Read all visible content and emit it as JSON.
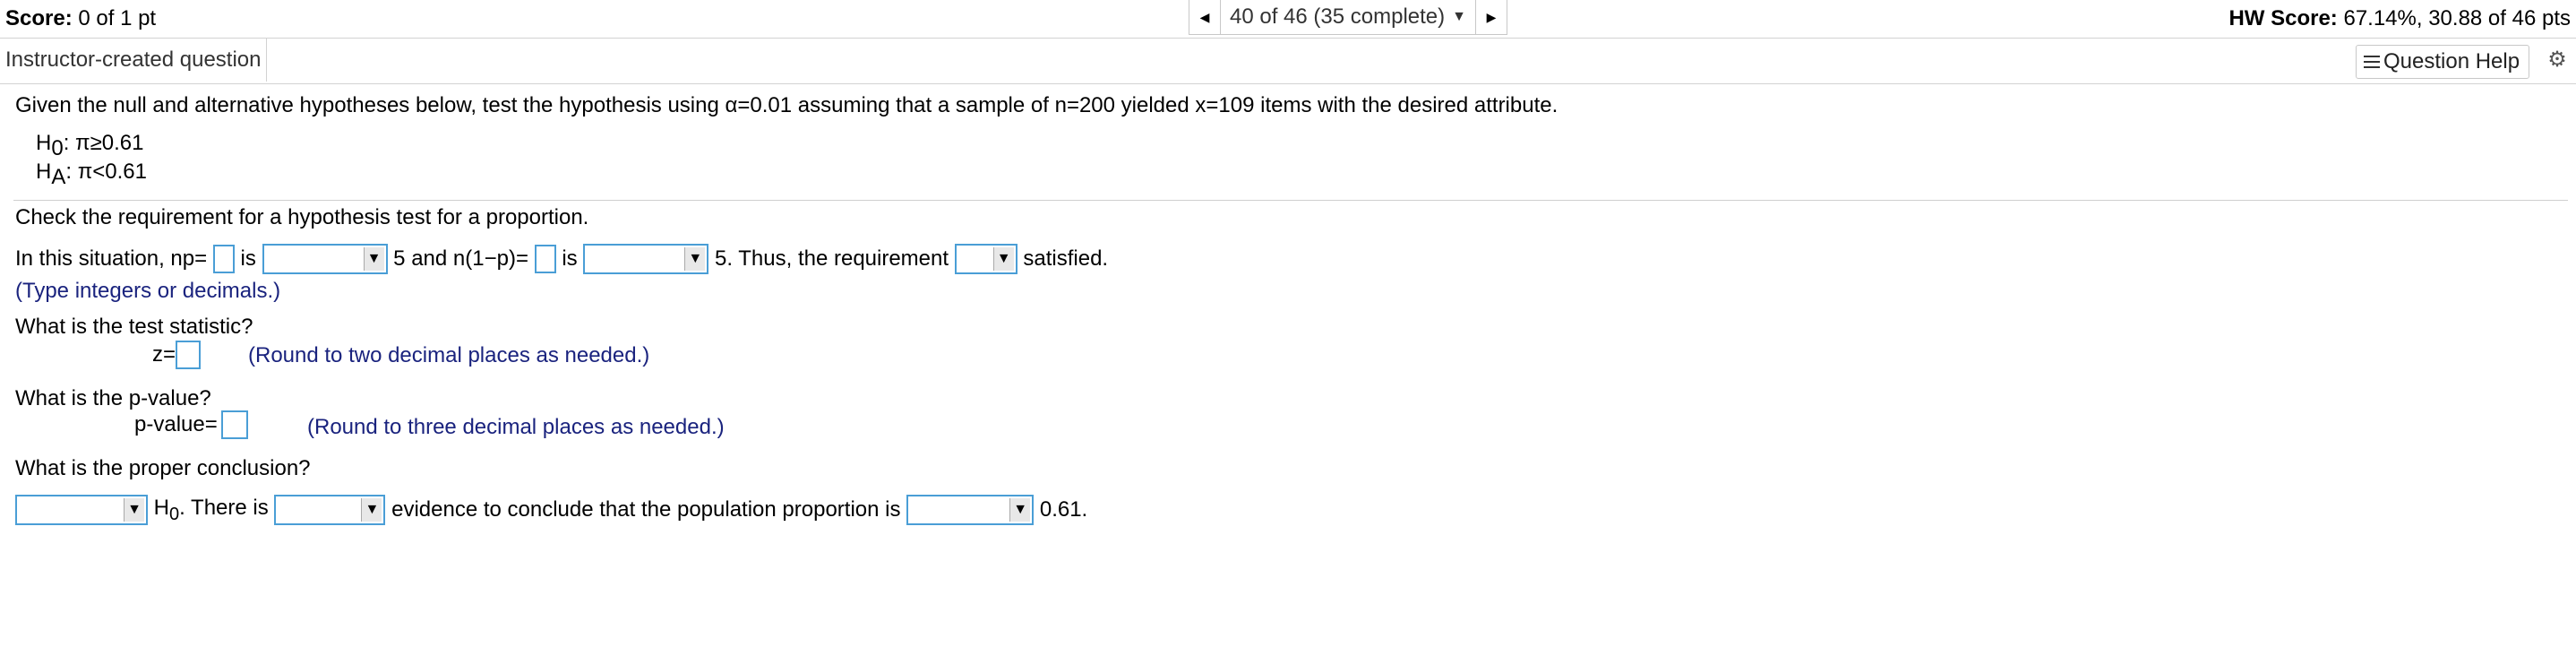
{
  "topbar": {
    "score_label": "Score:",
    "score_value": " 0 of 1 pt",
    "nav_label": "40 of 46 (35 complete)",
    "nav_caret": "▼",
    "prev_icon": "◀",
    "next_icon": "▶",
    "hw_label": "HW Score:",
    "hw_value": " 67.14%, 30.88 of 46 pts"
  },
  "subbar": {
    "instructor": "Instructor-created question",
    "help": "Question Help",
    "gear_icon": "⚙"
  },
  "question": {
    "prompt": "Given the null and alternative hypotheses below, test the hypothesis using α=0.01 assuming that a sample of n=200 yielded x=109 items with the desired attribute.",
    "h0_letter": "H",
    "h0_sub": "0",
    "h0_rest": ": π≥0.61",
    "ha_letter": "H",
    "ha_sub": "A",
    "ha_rest": ": π<0.61",
    "check_req": "Check the requirement for a hypothesis test for a proportion.",
    "sit_a": "In this situation, np=",
    "sit_b": " is ",
    "sit_c": " 5 and n(1−p)=",
    "sit_d": " is ",
    "sit_e": " 5. Thus, the requirement ",
    "sit_f": " satisfied.",
    "type_hint": "(Type integers or decimals.)",
    "test_stat_q": "What is the test statistic?",
    "z_label": "z=",
    "z_hint": "(Round to two decimal places as needed.)",
    "pval_q": "What is the p-value?",
    "pval_label": "p-value=",
    "pval_hint": "(Round to three decimal places as needed.)",
    "concl_q": "What is the proper conclusion?",
    "concl_a_h": "H",
    "concl_a_sub": "0",
    "concl_a_rest": ". There is ",
    "concl_b": " evidence to conclude that the population proportion is ",
    "concl_c": " 0.61.",
    "dd_arrow": "▼"
  }
}
